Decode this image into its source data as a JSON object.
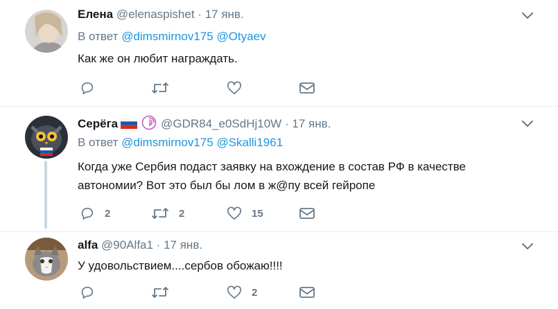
{
  "tweets": [
    {
      "name": "Елена",
      "handle": "@elenaspishet",
      "dot": "·",
      "time": "17 янв.",
      "reply_prefix": "В ответ",
      "mentions": [
        "@dimsmirnov175",
        "@Otyaev"
      ],
      "text_lines": [
        "Как же он любит награждать."
      ],
      "counts": {
        "reply": "",
        "retweet": "",
        "like": ""
      }
    },
    {
      "name": "Серёга",
      "handle": "@GDR84_e0SdHj10W",
      "dot": "·",
      "time": "17 янв.",
      "reply_prefix": "В ответ",
      "mentions": [
        "@dimsmirnov175",
        "@Skalli1961"
      ],
      "text_lines": [
        "Когда уже Сербия подаст заявку на вхождение в состав РФ в качестве",
        "автономии? Вот это был бы лом в ж@пу всей гейропе"
      ],
      "counts": {
        "reply": "2",
        "retweet": "2",
        "like": "15"
      }
    },
    {
      "name": "alfa",
      "handle": "@90Alfa1",
      "dot": "·",
      "time": "17 янв.",
      "text_lines": [
        "У удовольствием....сербов обожаю!!!!"
      ],
      "counts": {
        "reply": "",
        "retweet": "",
        "like": "2"
      }
    }
  ],
  "icons": {
    "reply": "reply-icon",
    "retweet": "retweet-icon",
    "like": "heart-icon",
    "dm": "envelope-icon",
    "menu": "chevron-down-icon"
  },
  "colors": {
    "mention": "#1b95e0",
    "muted": "#657786",
    "divider": "#e6ecf0",
    "thread_line": "#ccd6dd"
  }
}
